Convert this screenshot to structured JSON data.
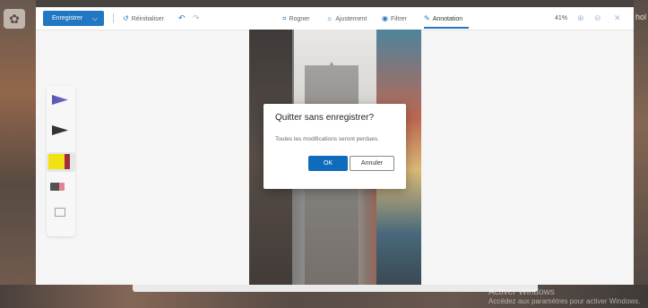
{
  "toolbar": {
    "save_label": "Enregistrer",
    "reset_label": "Réinitialiser",
    "crop_label": "Rogner",
    "adjust_label": "Ajustement",
    "filter_label": "Filtrer",
    "annotation_label": "Annotation",
    "zoom_value": "41%",
    "icons": {
      "save_chevron": "chevron-down-icon",
      "reset": "reset-icon",
      "undo": "undo-icon",
      "redo": "redo-icon",
      "crop": "crop-icon",
      "adjust": "adjust-icon",
      "filter": "filter-icon",
      "annotation": "pen-icon",
      "zoom_in": "zoom-in-icon",
      "zoom_out": "zoom-out-icon",
      "close": "close-icon"
    },
    "accent_color": "#0f6cbd"
  },
  "pens": [
    {
      "name": "ballpoint-pen",
      "color": "#5a50b8"
    },
    {
      "name": "pencil",
      "color": "#222222"
    },
    {
      "name": "highlighter",
      "color": "#f0e000",
      "selected": true
    },
    {
      "name": "eraser",
      "color": "#e07a8a"
    },
    {
      "name": "ruler",
      "color": "#999999"
    }
  ],
  "dialog": {
    "title": "Quitter sans enregistrer?",
    "message": "Toutes les modifications seront perdues.",
    "ok_label": "OK",
    "cancel_label": "Annuler"
  },
  "background": {
    "right_text": "hol",
    "watermark_line1": "Activer Windows",
    "watermark_line2": "Accédez aux paramètres pour activer Windows."
  }
}
